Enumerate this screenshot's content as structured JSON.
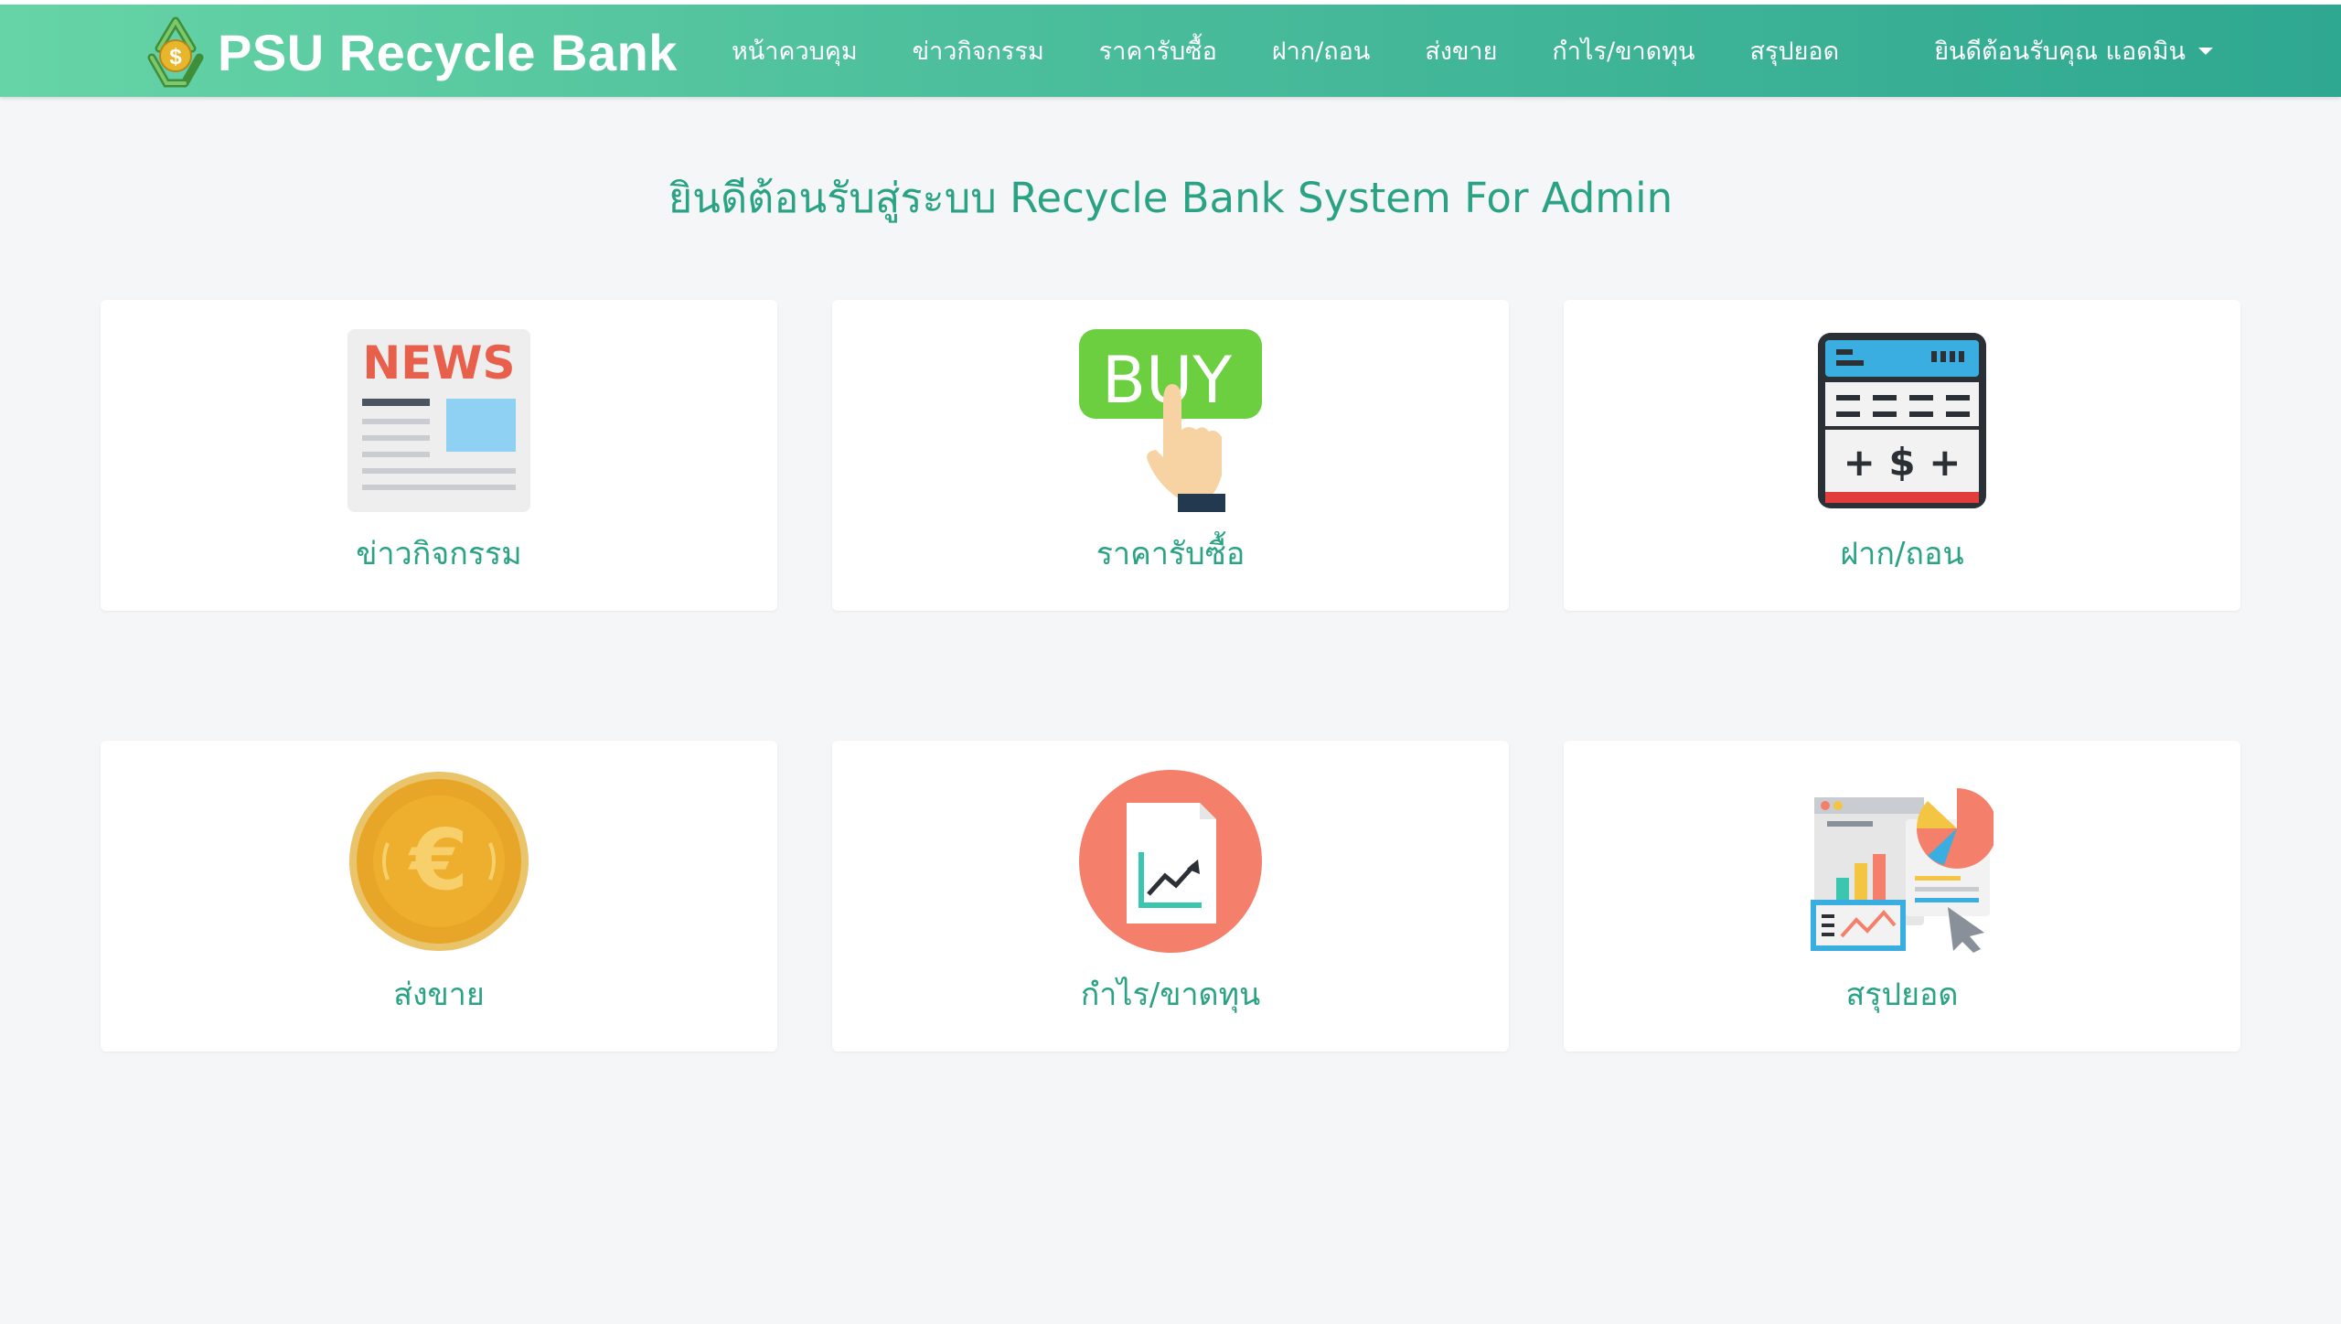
{
  "app": {
    "brand": "PSU Recycle Bank"
  },
  "nav": {
    "items": [
      {
        "label": "หน้าควบคุม"
      },
      {
        "label": "ข่าวกิจกรรม"
      },
      {
        "label": "ราคารับซื้อ"
      },
      {
        "label": "ฝาก/ถอน"
      },
      {
        "label": "ส่งขาย"
      },
      {
        "label": "กำไร/ขาดทุน"
      },
      {
        "label": "สรุปยอด"
      }
    ],
    "user_greeting": "ยินดีต้อนรับคุณ แอดมิน"
  },
  "main": {
    "title": "ยินดีต้อนรับสู่ระบบ Recycle Bank System For Admin",
    "cards": [
      {
        "label": "ข่าวกิจกรรม",
        "icon": "news-icon",
        "icon_text": "NEWS"
      },
      {
        "label": "ราคารับซื้อ",
        "icon": "buy-button-icon",
        "icon_text": "BUY"
      },
      {
        "label": "ฝาก/ถอน",
        "icon": "calculator-icon",
        "icon_text": "+ $ +"
      },
      {
        "label": "ส่งขาย",
        "icon": "euro-coin-icon",
        "icon_text": "€"
      },
      {
        "label": "กำไร/ขาดทุน",
        "icon": "profit-chart-icon"
      },
      {
        "label": "สรุปยอด",
        "icon": "report-dashboard-icon"
      }
    ]
  },
  "colors": {
    "nav_gradient_start": "#66d4a6",
    "nav_gradient_end": "#2fa891",
    "accent_text": "#2aa385",
    "page_background": "#f5f6f8"
  }
}
